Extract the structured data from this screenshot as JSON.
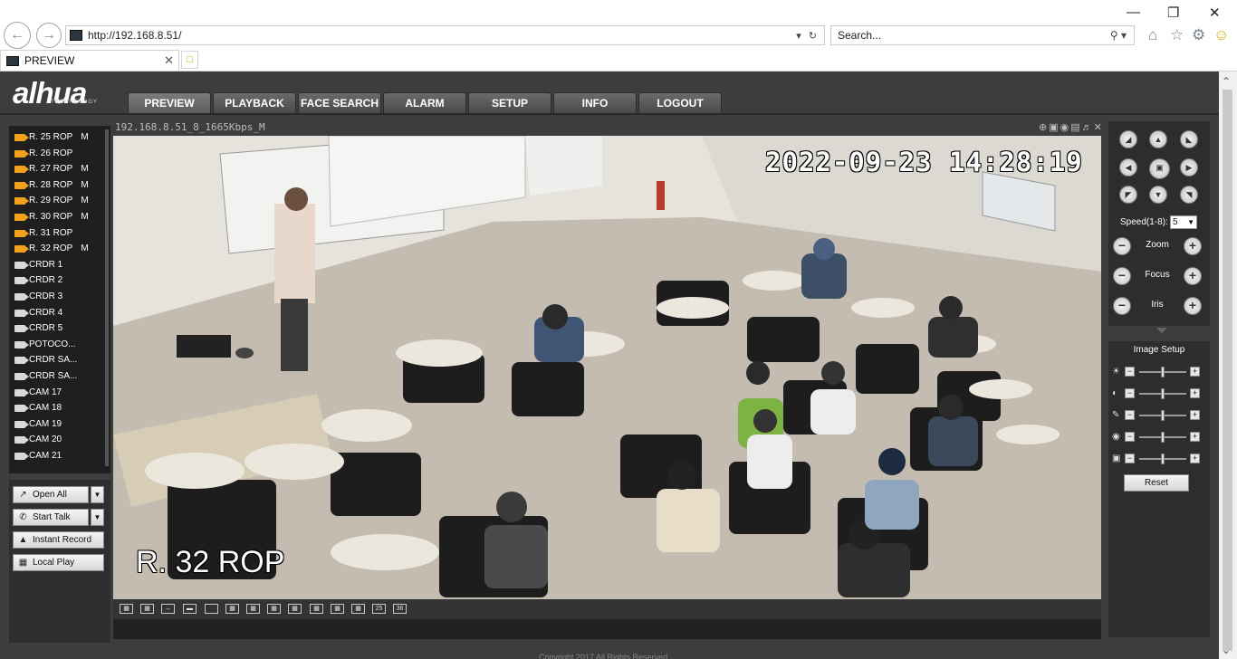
{
  "browser": {
    "url": "http://192.168.8.51/",
    "search_placeholder": "Search...",
    "tab_title": "PREVIEW"
  },
  "brand": {
    "logo": "alhua",
    "tagline": "TECHNOLOGY"
  },
  "nav": {
    "tabs": [
      "PREVIEW",
      "PLAYBACK",
      "FACE SEARCH",
      "ALARM",
      "SETUP",
      "INFO",
      "LOGOUT"
    ],
    "active": "PREVIEW"
  },
  "channels": [
    {
      "name": "R. 25 ROP",
      "flag": "M",
      "active": true
    },
    {
      "name": "R. 26 ROP",
      "flag": "",
      "active": true
    },
    {
      "name": "R. 27 ROP",
      "flag": "M",
      "active": true
    },
    {
      "name": "R. 28 ROP",
      "flag": "M",
      "active": true
    },
    {
      "name": "R. 29 ROP",
      "flag": "M",
      "active": true
    },
    {
      "name": "R. 30 ROP",
      "flag": "M",
      "active": true
    },
    {
      "name": "R. 31 ROP",
      "flag": "",
      "active": true
    },
    {
      "name": "R. 32 ROP",
      "flag": "M",
      "active": true
    },
    {
      "name": "CRDR 1",
      "flag": "",
      "active": false
    },
    {
      "name": "CRDR 2",
      "flag": "",
      "active": false
    },
    {
      "name": "CRDR 3",
      "flag": "",
      "active": false
    },
    {
      "name": "CRDR 4",
      "flag": "",
      "active": false
    },
    {
      "name": "CRDR 5",
      "flag": "",
      "active": false
    },
    {
      "name": "POTOCO...",
      "flag": "",
      "active": false
    },
    {
      "name": "CRDR SA...",
      "flag": "",
      "active": false
    },
    {
      "name": "CRDR SA...",
      "flag": "",
      "active": false
    },
    {
      "name": "CAM 17",
      "flag": "",
      "active": false
    },
    {
      "name": "CAM 18",
      "flag": "",
      "active": false
    },
    {
      "name": "CAM 19",
      "flag": "",
      "active": false
    },
    {
      "name": "CAM 20",
      "flag": "",
      "active": false
    },
    {
      "name": "CAM 21",
      "flag": "",
      "active": false
    }
  ],
  "actions": {
    "open_all": "Open All",
    "start_talk": "Start Talk",
    "instant_record": "Instant Record",
    "local_play": "Local Play"
  },
  "video": {
    "title": "192.168.8.51_8_1665Kbps_M",
    "timestamp": "2022-09-23 14:28:19",
    "channel_overlay": "R. 32 ROP"
  },
  "layouts": [
    "1",
    "2",
    "3",
    "4",
    "6",
    "8",
    "9",
    "13",
    "16",
    "20",
    "25",
    "36"
  ],
  "ptz": {
    "speed_label": "Speed(1-8):",
    "speed_value": "5",
    "controls": [
      "Zoom",
      "Focus",
      "Iris"
    ]
  },
  "image_setup": {
    "title": "Image Setup",
    "reset": "Reset",
    "sliders": [
      {
        "name": "brightness",
        "level": 0.5
      },
      {
        "name": "contrast",
        "level": 0.5
      },
      {
        "name": "saturation",
        "level": 0.5
      },
      {
        "name": "hue",
        "level": 0.5
      },
      {
        "name": "gain",
        "level": 0.5
      }
    ]
  },
  "footer": "Copyright 2017 All Rights Reserved."
}
